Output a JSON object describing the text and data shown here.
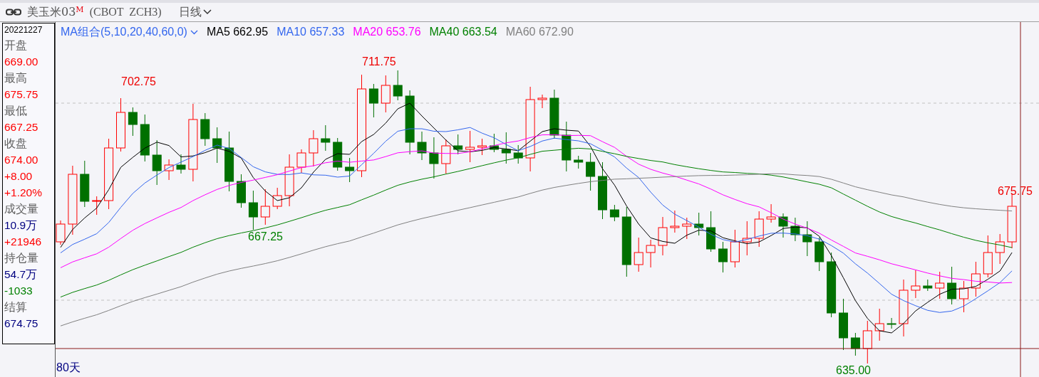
{
  "header": {
    "symbol": "美玉米03",
    "symbol_mark": "M",
    "exchange_code": "(CBOT  ZCH3)",
    "period": "日线"
  },
  "info_panel": {
    "date": "20221227",
    "items": [
      {
        "text": "开盘",
        "color": "#606060"
      },
      {
        "text": "669.00",
        "color": "#ff0000"
      },
      {
        "text": "最高",
        "color": "#606060"
      },
      {
        "text": "675.75",
        "color": "#ff0000"
      },
      {
        "text": "最低",
        "color": "#606060"
      },
      {
        "text": "667.25",
        "color": "#ff0000"
      },
      {
        "text": "收盘",
        "color": "#606060"
      },
      {
        "text": "674.00",
        "color": "#ff0000"
      },
      {
        "text": "+8.00",
        "color": "#ff0000"
      },
      {
        "text": "+1.20%",
        "color": "#ff0000"
      },
      {
        "text": "成交量",
        "color": "#606060"
      },
      {
        "text": "10.9万",
        "color": "#000080"
      },
      {
        "text": "+21946",
        "color": "#ff0000"
      },
      {
        "text": "持仓量",
        "color": "#606060"
      },
      {
        "text": "54.7万",
        "color": "#000080"
      },
      {
        "text": "-1033",
        "color": "#008000"
      },
      {
        "text": "结算",
        "color": "#606060"
      },
      {
        "text": "674.75",
        "color": "#000080"
      }
    ]
  },
  "legend": {
    "title": "MA组合(5,10,20,40,60,0)",
    "items": [
      {
        "label": "MA5 662.95",
        "color": "#000000"
      },
      {
        "label": "MA10 657.33",
        "color": "#3366ee"
      },
      {
        "label": "MA20 653.76",
        "color": "#ff00ff"
      },
      {
        "label": "MA40 663.54",
        "color": "#008000"
      },
      {
        "label": "MA60 672.90",
        "color": "#808080"
      }
    ]
  },
  "price_labels": [
    {
      "text": "702.75",
      "kind": "high"
    },
    {
      "text": "711.75",
      "kind": "high"
    },
    {
      "text": "667.25",
      "kind": "low"
    },
    {
      "text": "635.00",
      "kind": "low"
    },
    {
      "text": "675.75",
      "kind": "high"
    }
  ],
  "range_label": "80天"
}
